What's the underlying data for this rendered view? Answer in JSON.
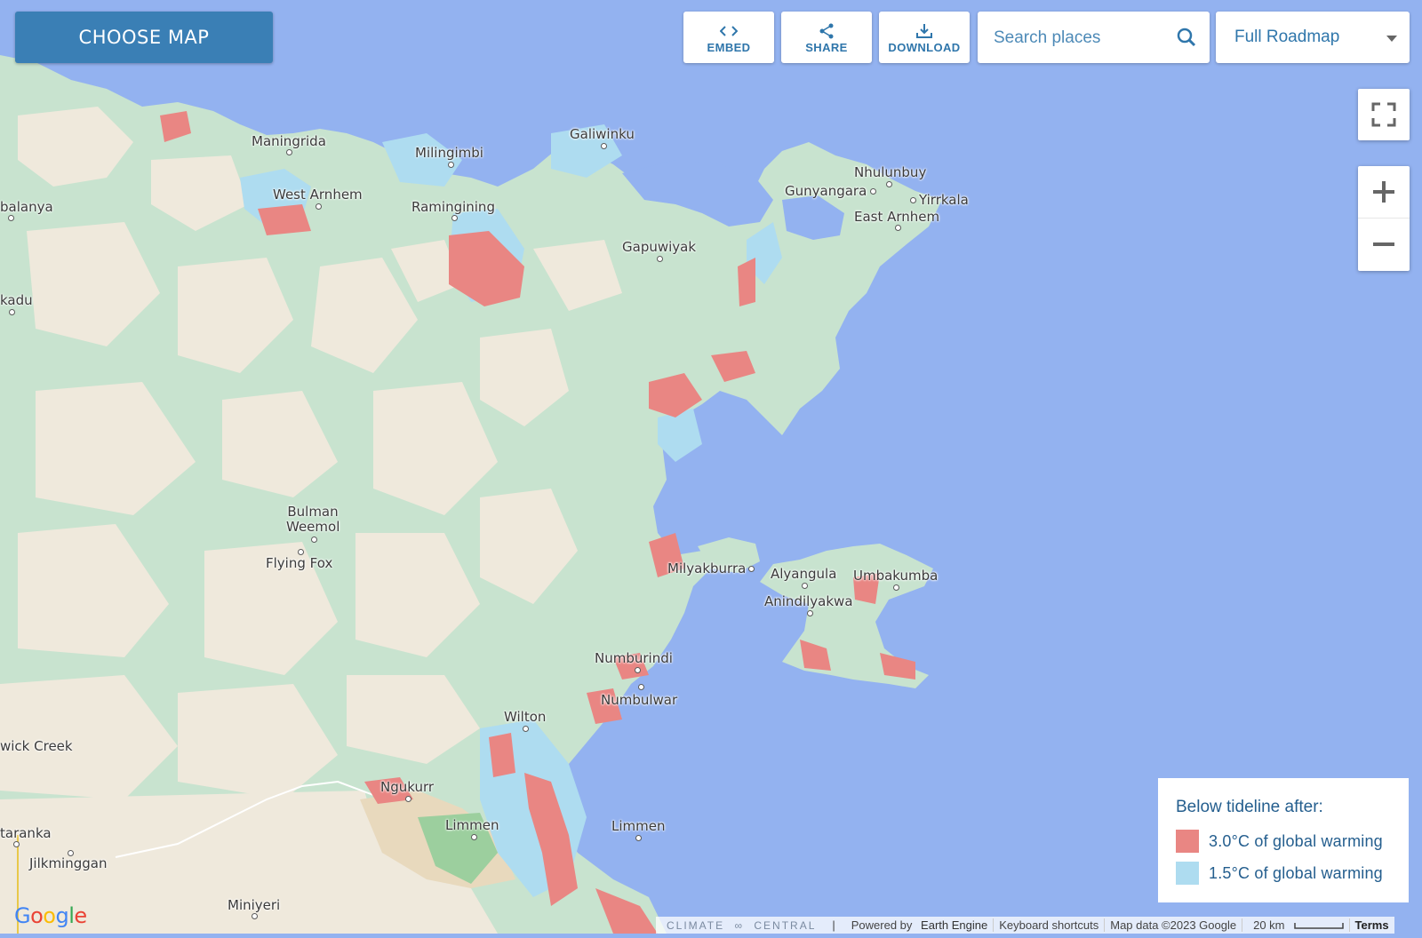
{
  "toolbar": {
    "choose_map_label": "CHOOSE MAP",
    "embed_label": "EMBED",
    "share_label": "SHARE",
    "download_label": "DOWNLOAD",
    "search_placeholder": "Search places",
    "map_style_value": "Full Roadmap"
  },
  "map": {
    "places": [
      {
        "name": "Maningrida"
      },
      {
        "name": "Milingimbi"
      },
      {
        "name": "Galiwinku"
      },
      {
        "name": "Nhulunbuy"
      },
      {
        "name": "Gunyangara"
      },
      {
        "name": "Yirrkala"
      },
      {
        "name": "West Arnhem"
      },
      {
        "name": "Ramingining"
      },
      {
        "name": "East Arnhem"
      },
      {
        "name": "balanya"
      },
      {
        "name": "Gapuwiyak"
      },
      {
        "name": "kadu"
      },
      {
        "name": "Bulman Weemol"
      },
      {
        "name": "Flying Fox"
      },
      {
        "name": "Milyakburra"
      },
      {
        "name": "Alyangula"
      },
      {
        "name": "Umbakumba"
      },
      {
        "name": "Anindilyakwa"
      },
      {
        "name": "Numburindi"
      },
      {
        "name": "Numbulwar"
      },
      {
        "name": "Wilton"
      },
      {
        "name": "wick Creek"
      },
      {
        "name": "Ngukurr"
      },
      {
        "name": "Limmen"
      },
      {
        "name": "Limmen"
      },
      {
        "name": "taranka"
      },
      {
        "name": "Jilkminggan"
      },
      {
        "name": "Miniyeri"
      }
    ],
    "water_color": "#93b2f0",
    "land_color": "#c8e3cf",
    "dry_color": "#efe9dc"
  },
  "legend": {
    "title": "Below tideline after:",
    "items": [
      {
        "label": "3.0°C of global warming",
        "color": "#e98683"
      },
      {
        "label": "1.5°C of global warming",
        "color": "#aedcf0"
      }
    ]
  },
  "attribution": {
    "brand_left": "CLIMATE",
    "brand_right": "CENTRAL",
    "powered_prefix": "Powered by",
    "powered_name": "Earth Engine",
    "keyboard": "Keyboard shortcuts",
    "map_data": "Map data ©2023 Google",
    "scale": "20 km",
    "terms": "Terms",
    "google_logo": "Google"
  }
}
